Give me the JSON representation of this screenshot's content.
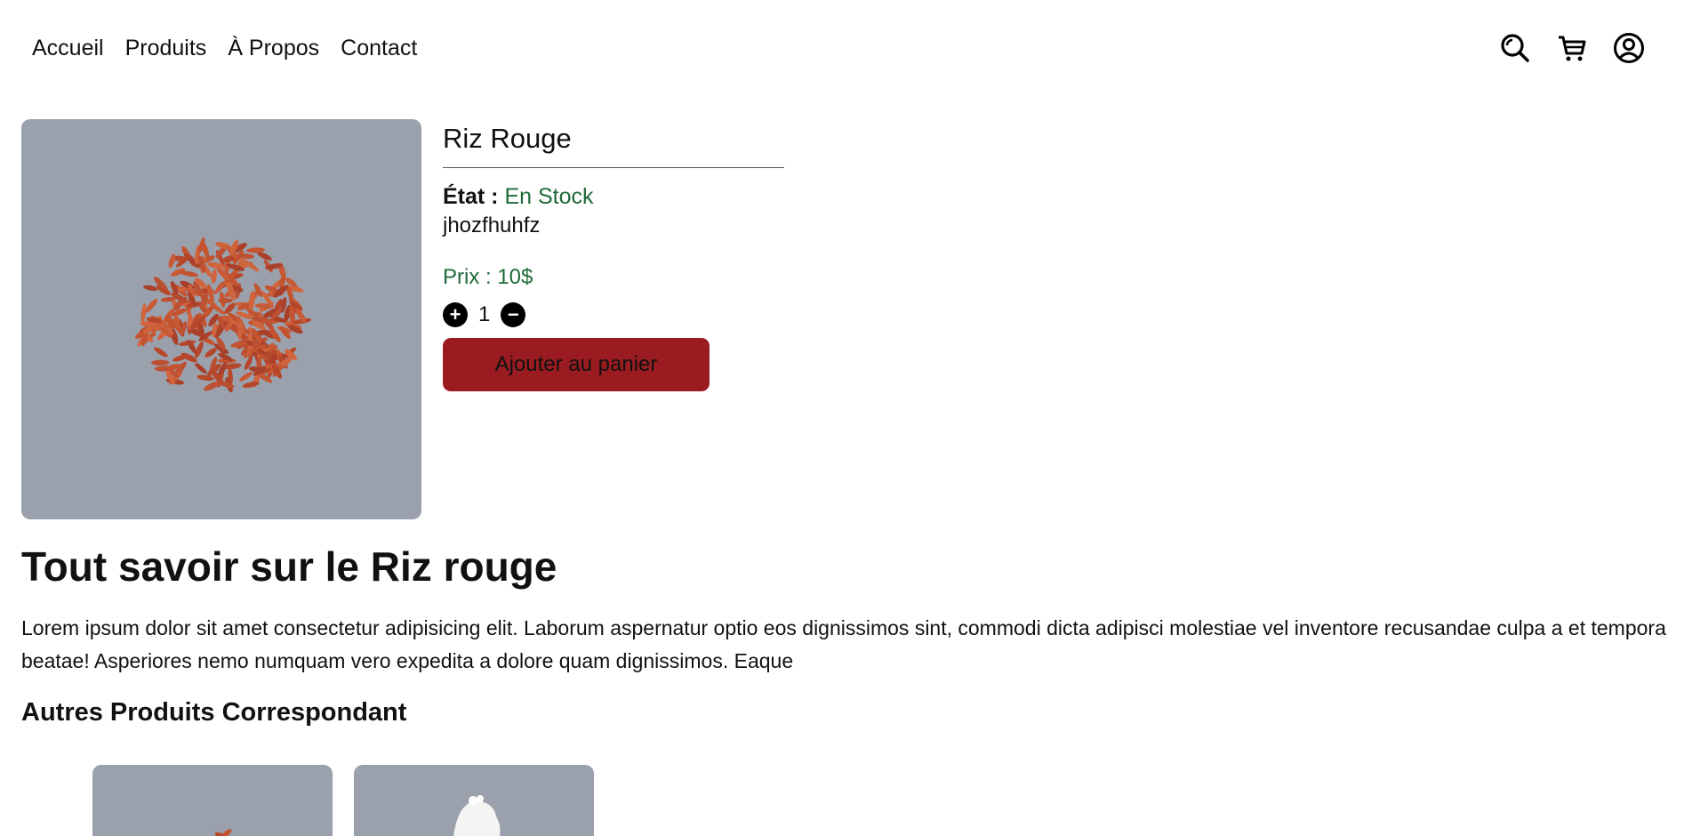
{
  "nav": {
    "links": [
      "Accueil",
      "Produits",
      "À Propos",
      "Contact"
    ],
    "icons": [
      "search-icon",
      "cart-icon",
      "user-icon"
    ]
  },
  "product": {
    "title": "Riz Rouge",
    "status_label": "État : ",
    "status_value": "En Stock",
    "description": "jhozfhuhfz",
    "price": "Prix : 10$",
    "quantity": "1",
    "add_to_cart": "Ajouter au panier"
  },
  "about": {
    "title": "Tout savoir sur le Riz rouge",
    "text": "Lorem ipsum dolor sit amet consectetur adipisicing elit. Laborum aspernatur optio eos dignissimos sint, commodi dicta adipisci molestiae vel inventore recusandae culpa a et tempora beatae! Asperiores nemo numquam vero expedita a dolore quam dignissimos. Eaque"
  },
  "related": {
    "title": "Autres Produits Correspondant"
  },
  "colors": {
    "image_bg": "#9aa1ad",
    "accent_green": "#1f6a3a",
    "button_red": "#9b1c20"
  }
}
